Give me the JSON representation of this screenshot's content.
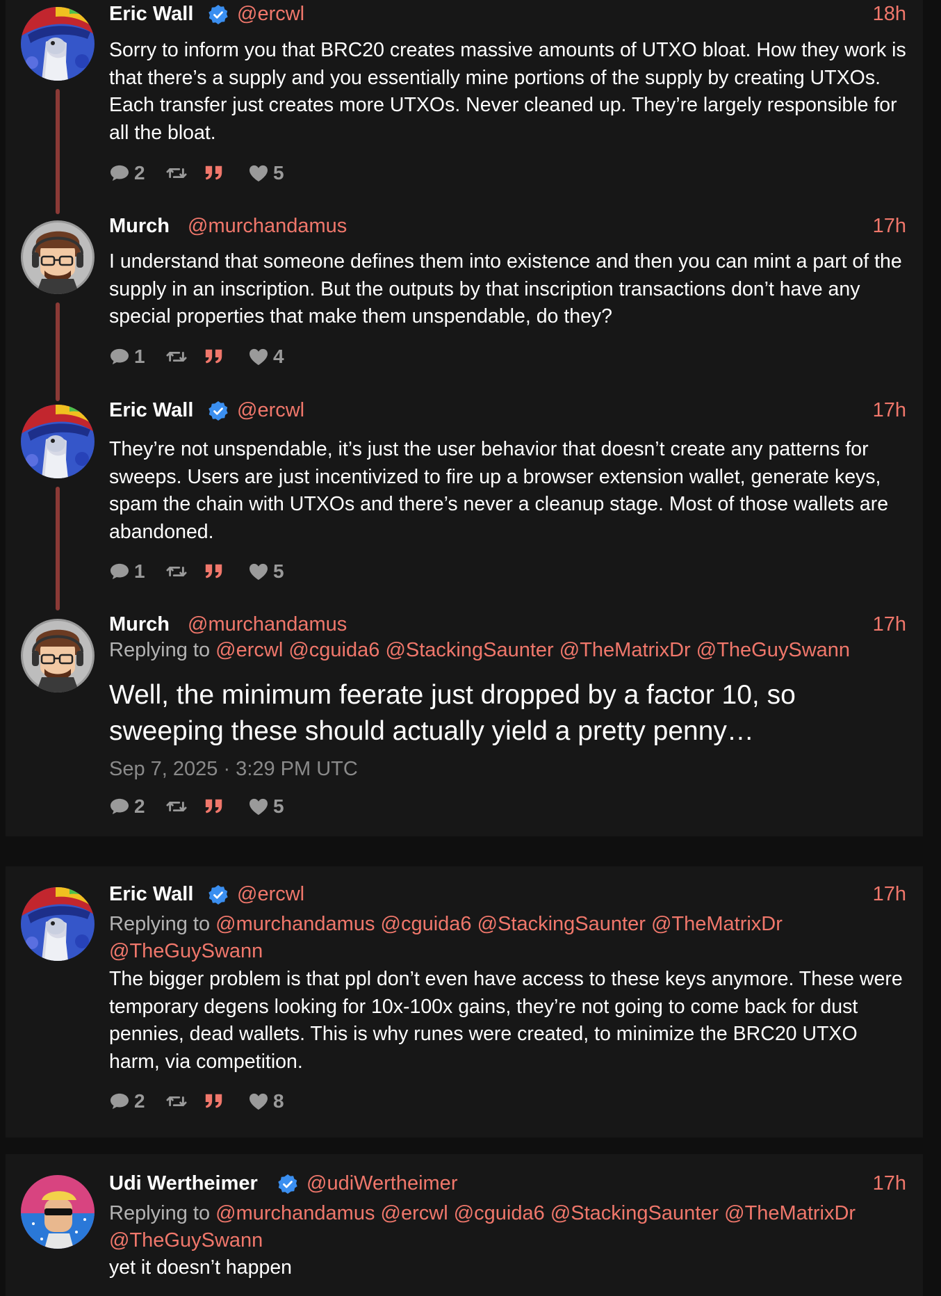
{
  "colors": {
    "accent": "#f0776b",
    "background": "#171717",
    "page": "#0f0f0f",
    "muted": "#9a9a9a",
    "verified": "#3b8ff0"
  },
  "tweets": [
    {
      "name": "Eric Wall",
      "handle": "@ercwl",
      "time": "18h",
      "verified": true,
      "text": "Sorry to inform you that BRC20 creates massive amounts of UTXO bloat. How they work is that there’s a supply and you essentially mine portions of the supply by creating UTXOs. Each transfer just creates more UTXOs. Never cleaned up. They’re largely responsible for all the bloat.",
      "stats": {
        "replies": "2",
        "likes": "5"
      }
    },
    {
      "name": "Murch",
      "handle": "@murchandamus",
      "time": "17h",
      "verified": false,
      "text": "I understand that someone defines them into existence and then you can mint a part of the supply in an inscription. But the outputs by that inscription transactions don’t have any special properties that make them unspendable, do they?",
      "stats": {
        "replies": "1",
        "likes": "4"
      }
    },
    {
      "name": "Eric Wall",
      "handle": "@ercwl",
      "time": "17h",
      "verified": true,
      "text": "They’re not unspendable, it’s just the user behavior that doesn’t create any patterns for sweeps. Users are just incentivized to fire up a browser extension wallet, generate keys, spam the chain with UTXOs and there’s never a cleanup stage. Most of those wallets are abandoned.",
      "stats": {
        "replies": "1",
        "likes": "5"
      }
    },
    {
      "name": "Murch",
      "handle": "@murchandamus",
      "time": "17h",
      "verified": false,
      "replying_label": "Replying to",
      "replying_to": [
        "@ercwl",
        "@cguida6",
        "@StackingSaunter",
        "@TheMatrixDr",
        "@TheGuySwann"
      ],
      "text": "Well, the minimum feerate just dropped by a factor 10, so sweeping these should actually yield a pretty penny…",
      "date": "Sep 7, 2025 · 3:29 PM UTC",
      "stats": {
        "replies": "2",
        "likes": "5"
      }
    },
    {
      "name": "Eric Wall",
      "handle": "@ercwl",
      "time": "17h",
      "verified": true,
      "replying_label": "Replying to",
      "replying_to": [
        "@murchandamus",
        "@cguida6",
        "@StackingSaunter",
        "@TheMatrixDr",
        "@TheGuySwann"
      ],
      "text": "The bigger problem is that ppl don’t even have access to these keys anymore. These were temporary degens looking for 10x-100x gains, they’re not going to come back for dust pennies, dead wallets. This is why runes were created, to minimize the BRC20 UTXO harm, via competition.",
      "stats": {
        "replies": "2",
        "likes": "8"
      }
    },
    {
      "name": "Udi Wertheimer",
      "handle": "@udiWertheimer",
      "time": "17h",
      "verified": true,
      "replying_label": "Replying to",
      "replying_to": [
        "@murchandamus",
        "@ercwl",
        "@cguida6",
        "@StackingSaunter",
        "@TheMatrixDr",
        "@TheGuySwann"
      ],
      "text": "yet it doesn’t happen"
    }
  ]
}
